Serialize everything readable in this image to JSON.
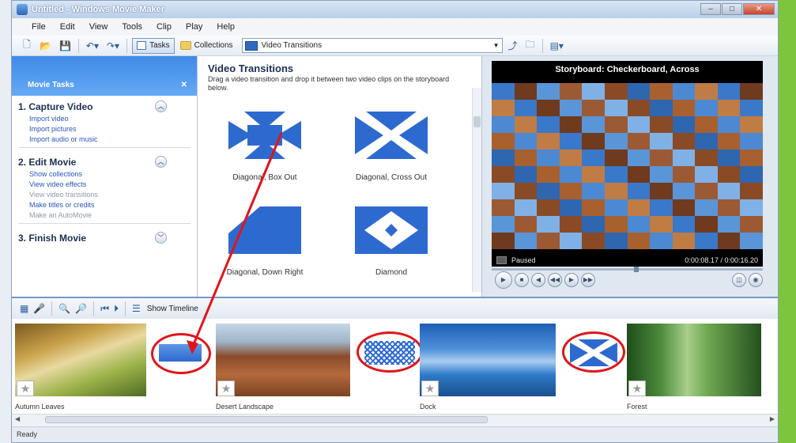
{
  "window": {
    "title": "Untitled - Windows Movie Maker",
    "controls": [
      "–",
      "□",
      "✕"
    ]
  },
  "menu": [
    "File",
    "Edit",
    "View",
    "Tools",
    "Clip",
    "Play",
    "Help"
  ],
  "toolbar": {
    "tasks_label": "Tasks",
    "collections_label": "Collections",
    "collection_select": "Video Transitions"
  },
  "task_pane": {
    "header": "Movie Tasks",
    "groups": [
      {
        "title": "1. Capture Video",
        "links": [
          "Import video",
          "Import pictures",
          "Import audio or music"
        ]
      },
      {
        "title": "2. Edit Movie",
        "links": [
          "Show collections",
          "View video effects",
          "View video transitions",
          "Make titles or credits",
          "Make an AutoMovie"
        ]
      },
      {
        "title": "3. Finish Movie",
        "links": []
      }
    ]
  },
  "collection": {
    "title": "Video Transitions",
    "subtitle": "Drag a video transition and drop it between two video clips on the storyboard below.",
    "items": [
      "Diagonal, Box Out",
      "Diagonal, Cross Out",
      "Diagonal, Down Right",
      "Diamond"
    ]
  },
  "preview": {
    "title": "Storyboard: Checkerboard, Across",
    "status": "Paused",
    "time": "0:00:08.17 / 0:00:16.20"
  },
  "storyboard": {
    "show_timeline": "Show Timeline",
    "clips": [
      "Autumn Leaves",
      "Desert Landscape",
      "Dock",
      "Forest"
    ]
  },
  "status_bar": "Ready",
  "colors": {
    "accent": "#3f8ae8",
    "transition_blue": "#2d6ad0",
    "highlight_red": "#e0151a"
  }
}
